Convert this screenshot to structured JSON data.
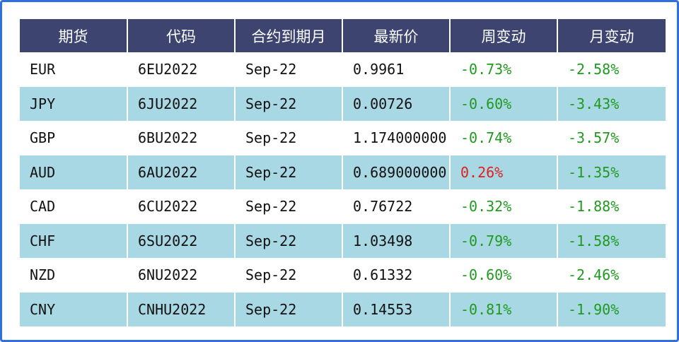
{
  "table": {
    "headers": [
      "期货",
      "代码",
      "合约到期月",
      "最新价",
      "周变动",
      "月变动"
    ],
    "rows": [
      [
        "EUR",
        "6EU2022",
        "Sep-22",
        "0.9961",
        "-0.73%",
        "-2.58%"
      ],
      [
        "JPY",
        "6JU2022",
        "Sep-22",
        "0.00726",
        "-0.60%",
        "-3.43%"
      ],
      [
        "GBP",
        "6BU2022",
        "Sep-22",
        "1.174000000",
        "-0.74%",
        "-3.57%"
      ],
      [
        "AUD",
        "6AU2022",
        "Sep-22",
        "0.689000000",
        "0.26%",
        "-1.35%"
      ],
      [
        "CAD",
        "6CU2022",
        "Sep-22",
        "0.76722",
        "-0.32%",
        "-1.88%"
      ],
      [
        "CHF",
        "6SU2022",
        "Sep-22",
        "1.03498",
        "-0.79%",
        "-1.58%"
      ],
      [
        "NZD",
        "6NU2022",
        "Sep-22",
        "0.61332",
        "-0.60%",
        "-2.46%"
      ],
      [
        "CNY",
        "CNHU2022",
        "Sep-22",
        "0.14553",
        "-0.81%",
        "-1.90%"
      ]
    ]
  },
  "colors": {
    "header_bg": "#3d4470",
    "stripe_bg": "#a8d8e4",
    "negative": "#1f9a1f",
    "positive": "#e02020",
    "border": "#2f6fe0"
  }
}
